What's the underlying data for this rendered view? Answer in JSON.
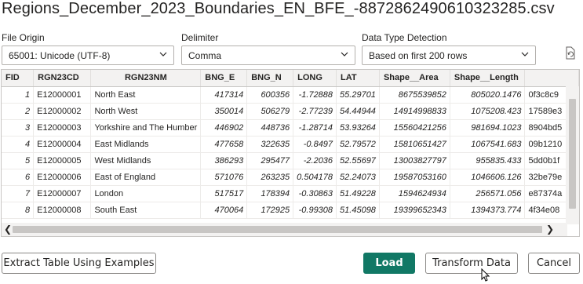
{
  "title": "Regions_December_2023_Boundaries_EN_BFE_-8872862490610323285.csv",
  "controls": {
    "file_origin_label": "File Origin",
    "file_origin_value": "65001: Unicode (UTF-8)",
    "delimiter_label": "Delimiter",
    "delimiter_value": "Comma",
    "detection_label": "Data Type Detection",
    "detection_value": "Based on first 200 rows"
  },
  "table": {
    "headers": [
      "FID",
      "RGN23CD",
      "RGN23NM",
      "BNG_E",
      "BNG_N",
      "LONG",
      "LAT",
      "Shape__Area",
      "Shape__Length",
      ""
    ],
    "rows": [
      [
        "1",
        "E12000001",
        "North East",
        "417314",
        "600356",
        "-1.72888",
        "55.29701",
        "8675539852",
        "805020.1476",
        "0f3c8c9"
      ],
      [
        "2",
        "E12000002",
        "North West",
        "350014",
        "506279",
        "-2.77239",
        "54.44944",
        "14914998833",
        "1075208.423",
        "17589e3"
      ],
      [
        "3",
        "E12000003",
        "Yorkshire and The Humber",
        "446902",
        "448736",
        "-1.28714",
        "53.93264",
        "15560421256",
        "981694.1023",
        "8904bd5"
      ],
      [
        "4",
        "E12000004",
        "East Midlands",
        "477658",
        "322635",
        "-0.8497",
        "52.79572",
        "15810651427",
        "1067541.683",
        "09b1210"
      ],
      [
        "5",
        "E12000005",
        "West Midlands",
        "386293",
        "295477",
        "-2.2036",
        "52.55697",
        "13003827797",
        "955835.433",
        "5dd0b1f"
      ],
      [
        "6",
        "E12000006",
        "East of England",
        "571076",
        "263235",
        "0.504178",
        "52.24073",
        "19587053160",
        "1046606.126",
        "32be79e"
      ],
      [
        "7",
        "E12000007",
        "London",
        "517517",
        "178394",
        "-0.30863",
        "51.49228",
        "1594624934",
        "256571.056",
        "e87374a"
      ],
      [
        "8",
        "E12000008",
        "South East",
        "470064",
        "172925",
        "-0.99308",
        "51.45098",
        "19399652343",
        "1394373.774",
        "4f34e08"
      ]
    ]
  },
  "buttons": {
    "extract": "Extract Table Using Examples",
    "load": "Load",
    "transform": "Transform Data",
    "cancel": "Cancel"
  },
  "colors": {
    "primary": "#117865",
    "header_bg": "#f3f2f1"
  },
  "icons": [
    "chevron-down-icon",
    "refresh-icon",
    "scroll-left-icon",
    "scroll-right-icon",
    "mouse-cursor-icon"
  ]
}
